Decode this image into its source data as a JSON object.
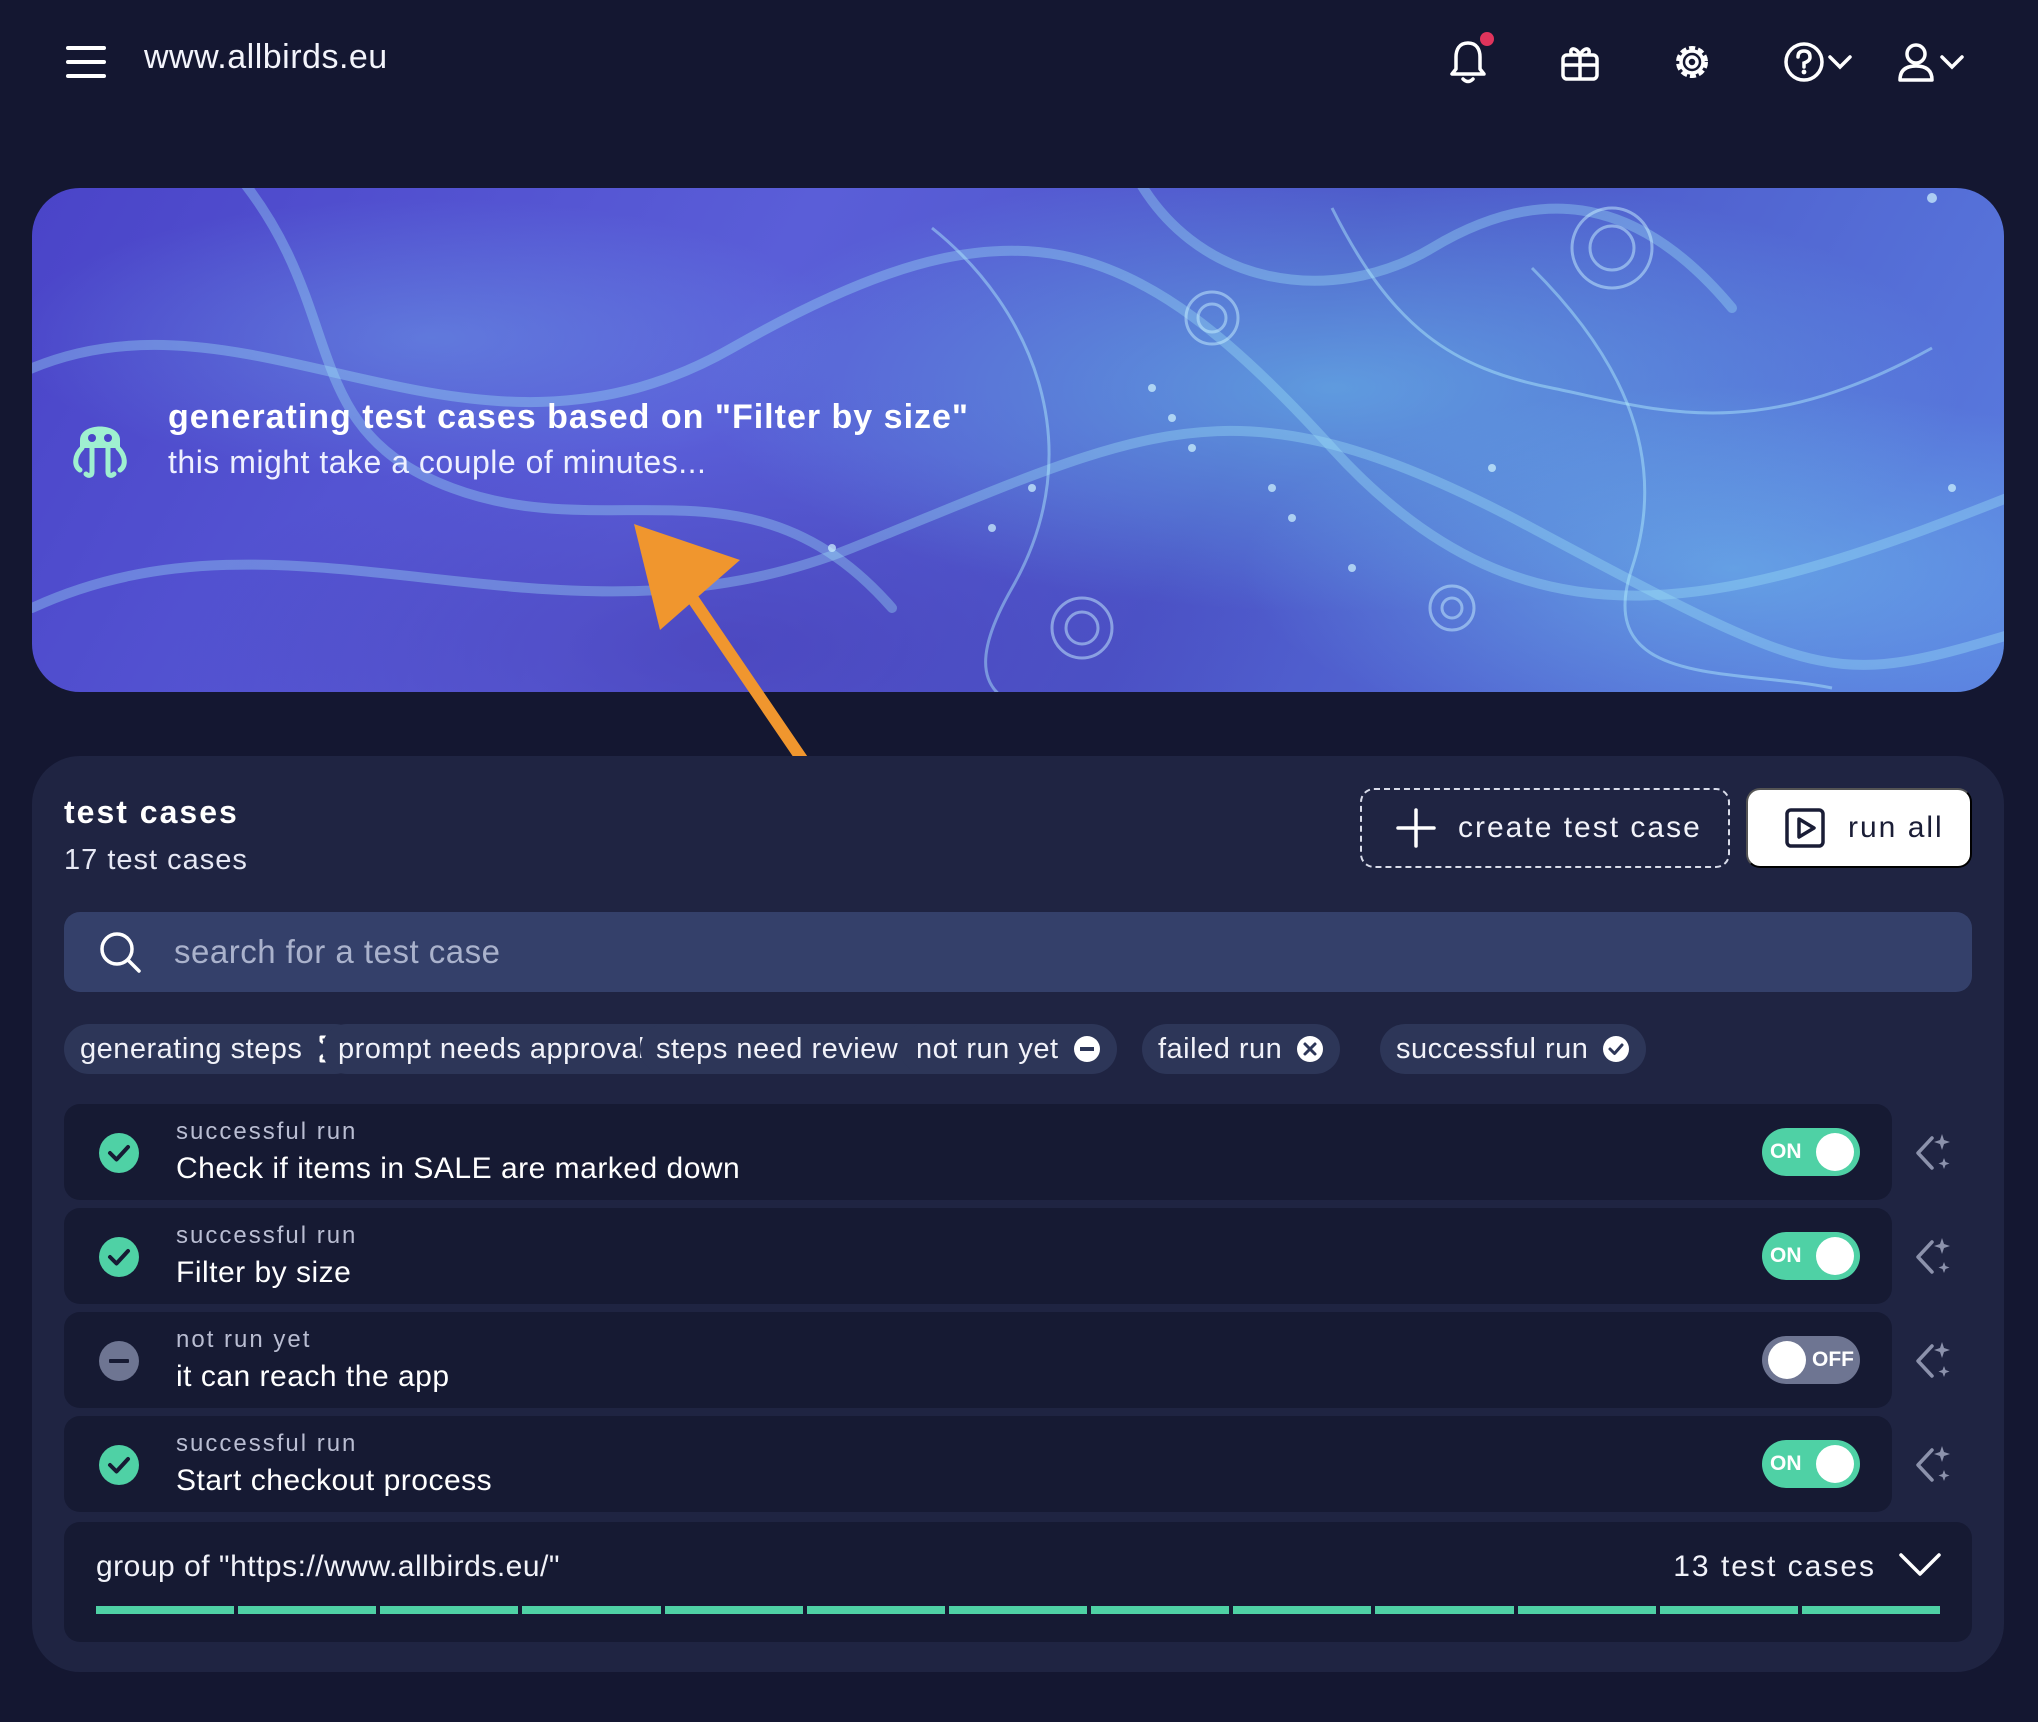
{
  "header": {
    "site_title": "www.allbirds.eu",
    "icons": [
      "menu-icon",
      "bell-icon",
      "gift-icon",
      "gear-icon",
      "help-icon",
      "user-icon"
    ]
  },
  "banner": {
    "title": "generating test cases based on \"Filter by size\"",
    "subtitle": "this might take a couple of minutes..."
  },
  "test_cases": {
    "title": "test cases",
    "count_label": "17 test cases",
    "create_label": "create test case",
    "run_all_label": "run all",
    "search_placeholder": "search for a test case",
    "filters": [
      {
        "label": "generating steps",
        "icon": "hourglass-icon"
      },
      {
        "label": "prompt needs approval",
        "icon": "thumbs-up-icon"
      },
      {
        "label": "steps need review",
        "icon": "warning-icon"
      },
      {
        "label": "not run yet",
        "icon": "minus-circle-icon"
      },
      {
        "label": "failed run",
        "icon": "x-circle-icon"
      },
      {
        "label": "successful run",
        "icon": "check-circle-icon"
      }
    ],
    "rows": [
      {
        "status": "successful run",
        "name": "Check if items in SALE are marked down",
        "toggle": "ON"
      },
      {
        "status": "successful run",
        "name": "Filter by size",
        "toggle": "ON"
      },
      {
        "status": "not run yet",
        "name": "it can reach the app",
        "toggle": "OFF"
      },
      {
        "status": "successful run",
        "name": "Start checkout process",
        "toggle": "ON"
      }
    ],
    "group": {
      "label": "group of \"https://www.allbirds.eu/\"",
      "count_label": "13 test cases",
      "progress_segments": 13
    }
  },
  "colors": {
    "background": "#141731",
    "panel": "#1f2442",
    "success": "#4fd1a5",
    "off": "#6e7592",
    "annotation_arrow": "#f0962e"
  }
}
